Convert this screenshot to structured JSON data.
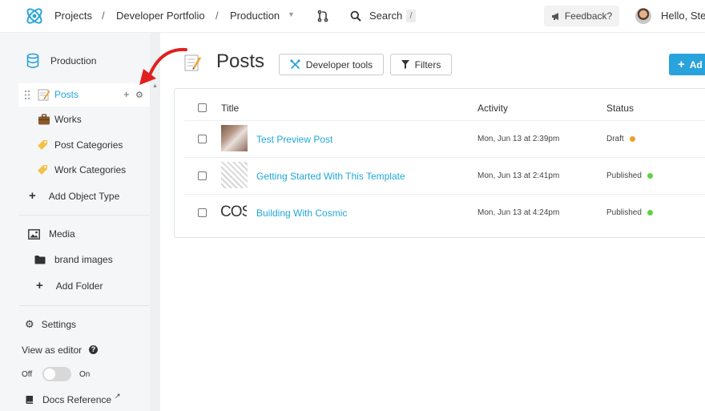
{
  "topbar": {
    "crumb_projects": "Projects",
    "crumb_portfolio": "Developer Portfolio",
    "crumb_production": "Production",
    "separator": "/",
    "search_label": "Search",
    "search_shortcut": "/",
    "feedback_label": "Feedback?",
    "greeting": "Hello, Ste"
  },
  "sidebar": {
    "bucket": "Production",
    "posts": "Posts",
    "works": "Works",
    "post_categories": "Post Categories",
    "work_categories": "Work Categories",
    "add_object_type": "Add Object Type",
    "media": "Media",
    "brand_images": "brand images",
    "add_folder": "Add Folder",
    "settings": "Settings",
    "view_as_editor": "View as editor",
    "toggle_off": "Off",
    "toggle_on": "On",
    "toggle_state": "off",
    "docs_reference": "Docs Reference"
  },
  "main": {
    "title": "Posts",
    "developer_tools": "Developer tools",
    "filters": "Filters",
    "add_label": "Ad"
  },
  "table": {
    "headers": {
      "title": "Title",
      "activity": "Activity",
      "status": "Status"
    },
    "rows": [
      {
        "title": "Test Preview Post",
        "activity": "Mon, Jun 13 at 2:39pm",
        "status": "Draft",
        "status_color": "#f0a030",
        "thumb": "photo"
      },
      {
        "title": "Getting Started With This Template",
        "activity": "Mon, Jun 13 at 2:41pm",
        "status": "Published",
        "status_color": "#5fd33f",
        "thumb": "keyboard"
      },
      {
        "title": "Building With Cosmic",
        "activity": "Mon, Jun 13 at 4:24pm",
        "status": "Published",
        "status_color": "#5fd33f",
        "thumb": "COS"
      }
    ]
  },
  "colors": {
    "accent": "#29a3db",
    "link": "#1fa8d8",
    "annotation_arrow": "#e02020"
  }
}
